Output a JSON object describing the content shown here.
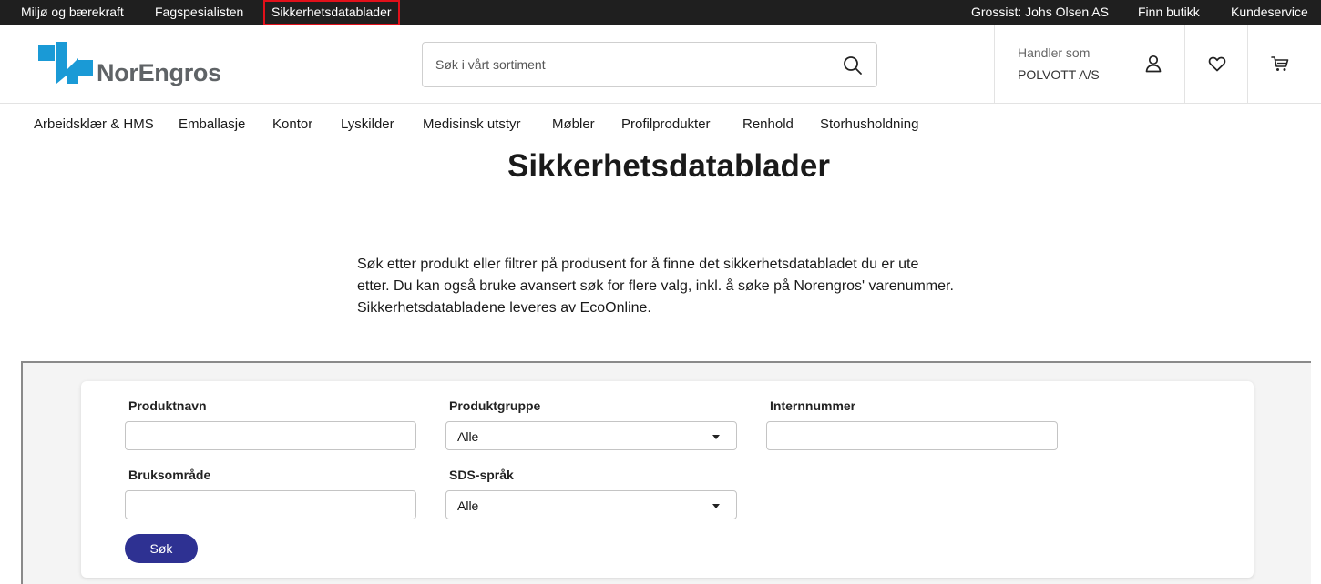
{
  "topbar": {
    "links": [
      "Miljø og bærekraft",
      "Fagspesialisten",
      "Sikkerhetsdatablader"
    ],
    "grossist": "Grossist: Johs Olsen AS",
    "finn_butikk": "Finn butikk",
    "kundeservice": "Kundeservice"
  },
  "header": {
    "logo_text": "NorEngros",
    "search_placeholder": "Søk i vårt sortiment",
    "handler_label": "Handler som",
    "handler_name": "POLVOTT A/S",
    "icons": [
      "search-icon",
      "user-icon",
      "heart-icon",
      "cart-icon"
    ]
  },
  "categories": [
    "Arbeidsklær & HMS",
    "Emballasje",
    "Kontor",
    "Lyskilder",
    "Medisinsk utstyr",
    "Møbler",
    "Profilprodukter",
    "Renhold",
    "Storhusholdning"
  ],
  "page": {
    "title": "Sikkerhetsdatablader",
    "intro": [
      "Søk etter produkt eller filtrer på produsent for å finne det sikkerhetsdatabladet du er ute",
      "etter. Du kan også bruke avansert søk for flere valg, inkl. å søke på Norengros' varenummer.",
      "Sikkerhetsdatabladene leveres av EcoOnline."
    ]
  },
  "form": {
    "produktnavn_label": "Produktnavn",
    "produktnavn_value": "",
    "produktgruppe_label": "Produktgruppe",
    "produktgruppe_value": "Alle",
    "internnummer_label": "Internnummer",
    "internnummer_value": "",
    "bruksomrade_label": "Bruksområde",
    "bruksomrade_value": "",
    "sds_sprak_label": "SDS-språk",
    "sds_sprak_value": "Alle",
    "submit_label": "Søk"
  },
  "colors": {
    "topbar_bg": "#1f1f1f",
    "active_outline": "#e1101a",
    "logo_blue": "#1a9ad6",
    "button_bg": "#2e3192"
  }
}
